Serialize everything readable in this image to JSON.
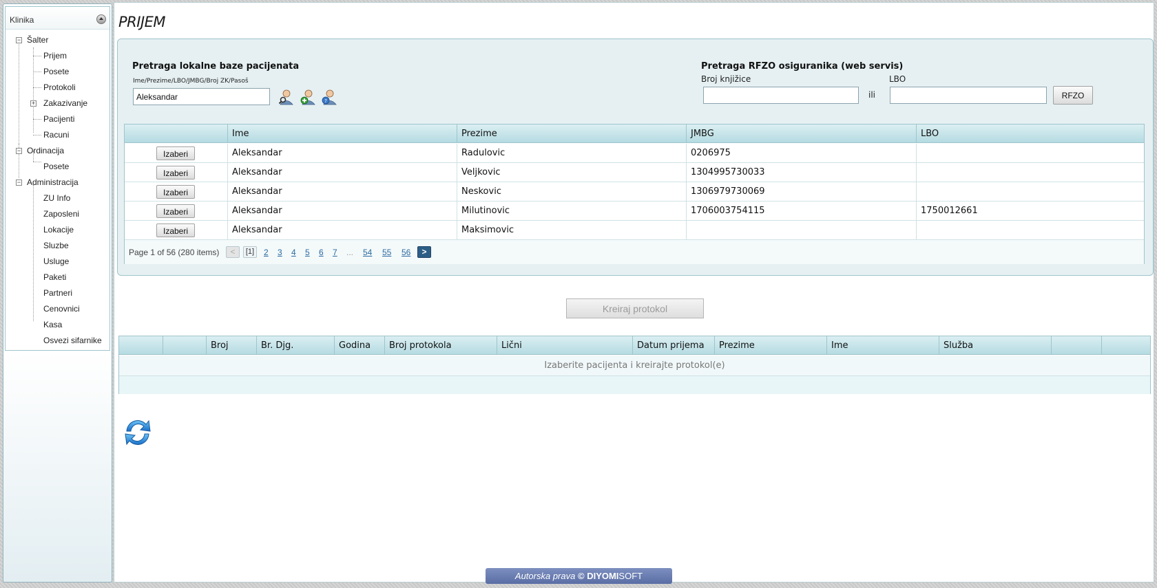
{
  "sidebar": {
    "title": "Klinika",
    "tree": [
      {
        "label": "Šalter",
        "toggle": "−"
      },
      {
        "label": "Prijem"
      },
      {
        "label": "Posete"
      },
      {
        "label": "Protokoli"
      },
      {
        "label": "Zakazivanje",
        "toggle": "+"
      },
      {
        "label": "Pacijenti"
      },
      {
        "label": "Racuni"
      },
      {
        "label": "Ordinacija",
        "toggle": "−"
      },
      {
        "label": "Posete"
      },
      {
        "label": "Administracija",
        "toggle": "−"
      },
      {
        "label": "ZU Info"
      },
      {
        "label": "Zaposleni"
      },
      {
        "label": "Lokacije"
      },
      {
        "label": "Sluzbe"
      },
      {
        "label": "Usluge"
      },
      {
        "label": "Paketi"
      },
      {
        "label": "Partneri"
      },
      {
        "label": "Cenovnici"
      },
      {
        "label": "Kasa"
      },
      {
        "label": "Osvezi sifarnike"
      }
    ]
  },
  "page": {
    "title": "PRIJEM"
  },
  "local_search": {
    "title": "Pretraga lokalne baze pacijenata",
    "field_label": "Ime/Prezime/LBO/JMBG/Broj ZK/Pasoš",
    "value": "Aleksandar",
    "icons": [
      "search-patient-icon",
      "add-patient-icon",
      "patient-info-icon"
    ]
  },
  "rfzo_search": {
    "title": "Pretraga RFZO osiguranika (web servis)",
    "broj_label": "Broj knjižice",
    "broj_value": "",
    "ili": "ili",
    "lbo_label": "LBO",
    "lbo_value": "",
    "button": "RFZO"
  },
  "patients_grid": {
    "columns": [
      "",
      "Ime",
      "Prezime",
      "JMBG",
      "LBO"
    ],
    "select_label": "Izaberi",
    "rows": [
      {
        "ime": "Aleksandar",
        "prezime": "Radulovic",
        "jmbg": "0206975",
        "lbo": ""
      },
      {
        "ime": "Aleksandar",
        "prezime": "Veljkovic",
        "jmbg": "1304995730033",
        "lbo": ""
      },
      {
        "ime": "Aleksandar",
        "prezime": "Neskovic",
        "jmbg": "1306979730069",
        "lbo": ""
      },
      {
        "ime": "Aleksandar",
        "prezime": "Milutinovic",
        "jmbg": "1706003754115",
        "lbo": "1750012661"
      },
      {
        "ime": "Aleksandar",
        "prezime": "Maksimovic",
        "jmbg": "",
        "lbo": ""
      }
    ],
    "pager": {
      "summary": "Page 1 of 56 (280 items)",
      "prev": "<",
      "current": "[1]",
      "pages": [
        "2",
        "3",
        "4",
        "5",
        "6",
        "7"
      ],
      "ellipsis": "...",
      "last_pages": [
        "54",
        "55",
        "56"
      ],
      "next": ">"
    }
  },
  "create_button": "Kreiraj protokol",
  "protocols_grid": {
    "columns": [
      "",
      "",
      "Broj",
      "Br. Djg.",
      "Godina",
      "Broj protokola",
      "Lični",
      "Datum prijema",
      "Prezime",
      "Ime",
      "Služba",
      "",
      ""
    ],
    "empty_text": "Izaberite pacijenta i kreirajte protokol(e)"
  },
  "footer": {
    "prefix": "Autorska prava",
    "copyright": "©",
    "brand_bold": "DIYOMI",
    "brand_rest": "SOFT"
  }
}
